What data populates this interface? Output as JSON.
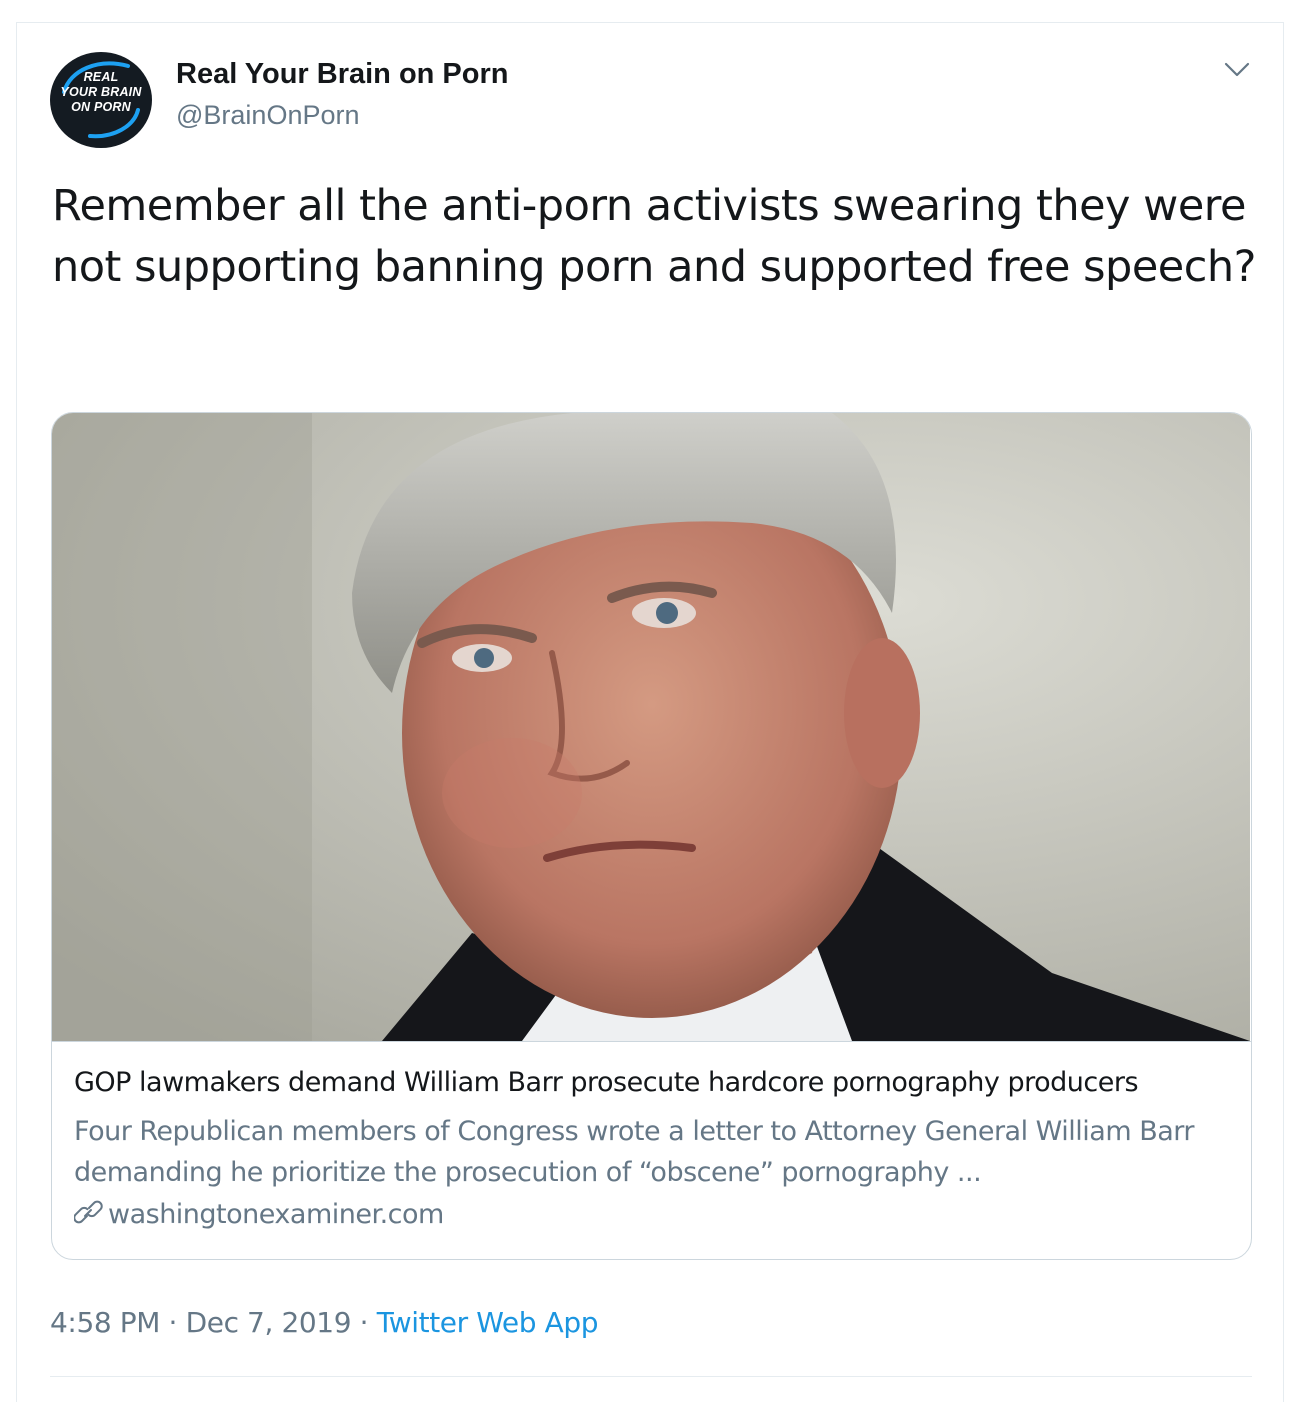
{
  "tweet": {
    "avatar_logo_lines": [
      "REAL",
      "YOUR BRAIN",
      "ON PORN"
    ],
    "display_name": "Real Your Brain on Porn",
    "handle": "@BrainOnPorn",
    "text": "Remember all the anti-porn activists swearing they were not supporting banning porn and supported free speech?",
    "more_icon": "chevron-down-icon"
  },
  "card": {
    "title": "GOP lawmakers demand William Barr prosecute hardcore pornography producers",
    "description": "Four Republican members of Congress wrote a letter to Attorney General William Barr demanding he prioritize the prosecution of “obscene” pornography ...",
    "domain": "washingtonexaminer.com",
    "domain_icon": "link-icon"
  },
  "meta": {
    "time": "4:58 PM",
    "separator": "·",
    "date": "Dec 7, 2019",
    "source": "Twitter Web App"
  },
  "colors": {
    "text_primary": "#14171a",
    "text_secondary": "#657786",
    "link": "#1b95e0",
    "border": "#ccd6dd",
    "avatar_bg": "#141b22"
  }
}
